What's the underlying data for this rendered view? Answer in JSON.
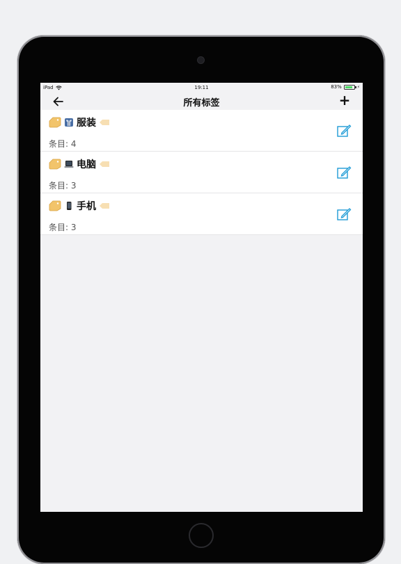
{
  "status_bar": {
    "device": "iPad",
    "time": "19:11",
    "battery": "83%",
    "battery_level": 0.83
  },
  "nav": {
    "title": "所有标签",
    "add_label": "+"
  },
  "tags": [
    {
      "name": "服装",
      "count_label": "条目: 4",
      "icon": "clothing-icon"
    },
    {
      "name": "电脑",
      "count_label": "条目: 3",
      "icon": "laptop-icon"
    },
    {
      "name": "手机",
      "count_label": "条目: 3",
      "icon": "phone-icon"
    }
  ],
  "colors": {
    "accent": "#1e9bd6",
    "tag": "#f2c46b",
    "background": "#f2f2f4"
  }
}
